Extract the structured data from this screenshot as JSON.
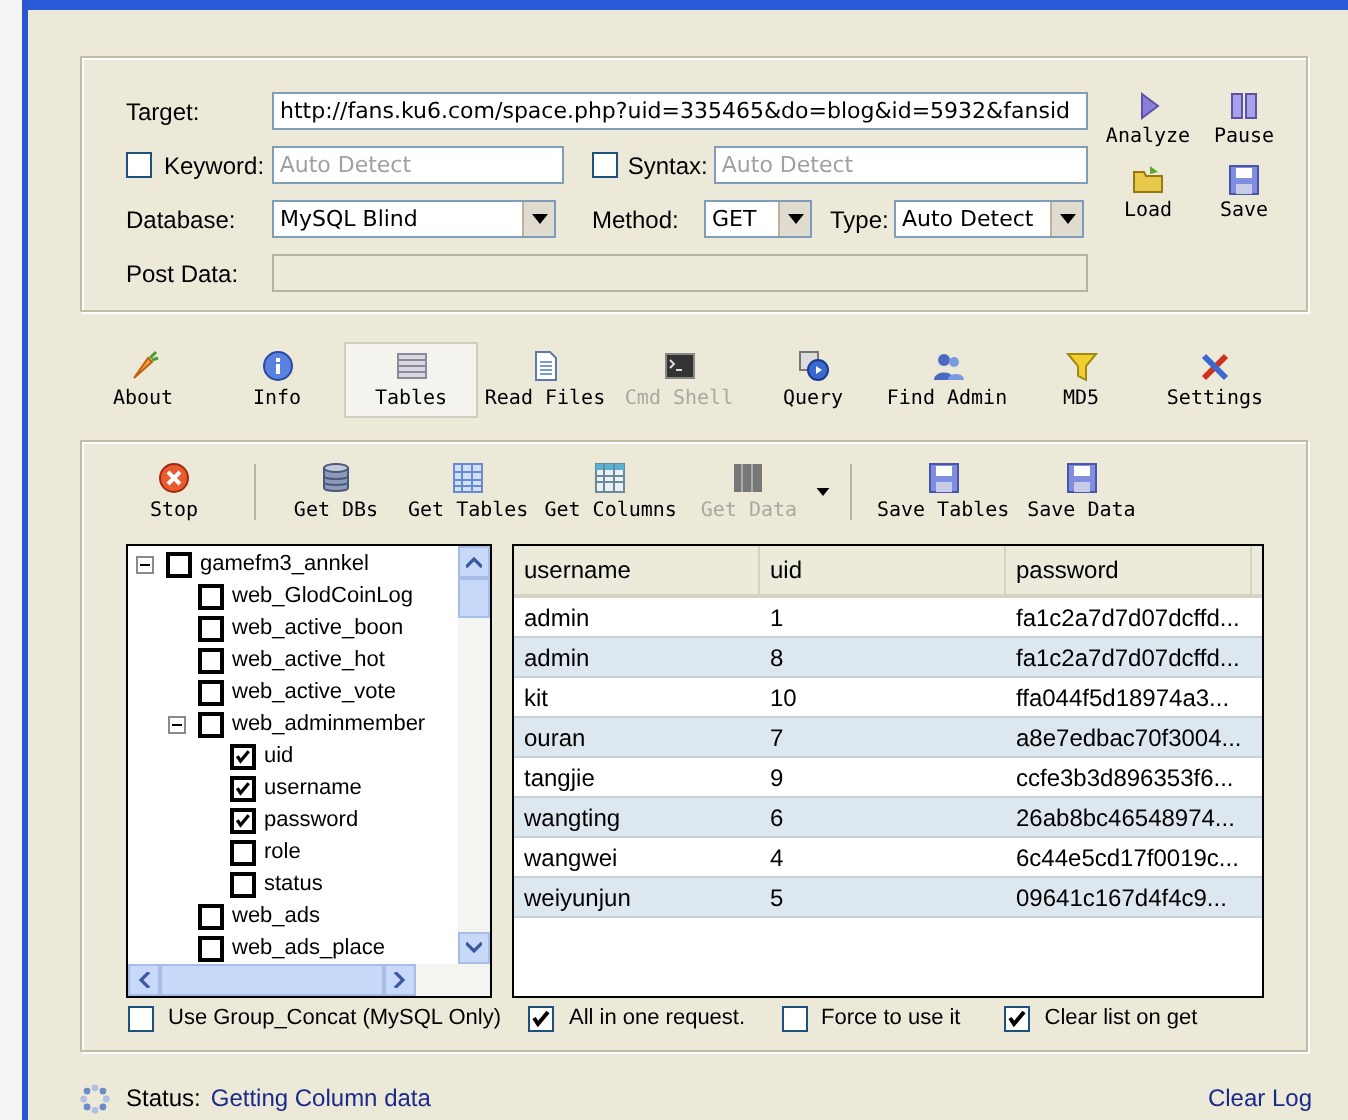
{
  "target": {
    "label": "Target:",
    "value": "http://fans.ku6.com/space.php?uid=335465&do=blog&id=5932&fansid"
  },
  "keyword": {
    "label": "Keyword:",
    "checked": false,
    "placeholder": "Auto Detect"
  },
  "syntax": {
    "label": "Syntax:",
    "checked": false,
    "placeholder": "Auto Detect"
  },
  "database": {
    "label": "Database:",
    "value": "MySQL Blind"
  },
  "method": {
    "label": "Method:",
    "value": "GET"
  },
  "type": {
    "label": "Type:",
    "value": "Auto Detect"
  },
  "post_data": {
    "label": "Post Data:",
    "disabled": true
  },
  "actions": [
    {
      "label": "Analyze"
    },
    {
      "label": "Pause"
    },
    {
      "label": "Load"
    },
    {
      "label": "Save"
    }
  ],
  "tabs": [
    {
      "label": "About",
      "selected": false,
      "disabled": false
    },
    {
      "label": "Info",
      "selected": false,
      "disabled": false
    },
    {
      "label": "Tables",
      "selected": true,
      "disabled": false
    },
    {
      "label": "Read Files",
      "selected": false,
      "disabled": false
    },
    {
      "label": "Cmd Shell",
      "selected": false,
      "disabled": true
    },
    {
      "label": "Query",
      "selected": false,
      "disabled": false
    },
    {
      "label": "Find Admin",
      "selected": false,
      "disabled": false
    },
    {
      "label": "MD5",
      "selected": false,
      "disabled": false
    },
    {
      "label": "Settings",
      "selected": false,
      "disabled": false
    }
  ],
  "toolbar": [
    {
      "kind": "button",
      "label": "Stop",
      "disabled": false
    },
    {
      "kind": "separator"
    },
    {
      "kind": "button",
      "label": "Get DBs",
      "disabled": false
    },
    {
      "kind": "button",
      "label": "Get Tables",
      "disabled": false
    },
    {
      "kind": "button",
      "label": "Get Columns",
      "disabled": false
    },
    {
      "kind": "button",
      "label": "Get Data",
      "disabled": true
    },
    {
      "kind": "dropdown"
    },
    {
      "kind": "separator"
    },
    {
      "kind": "button",
      "label": "Save Tables",
      "disabled": false
    },
    {
      "kind": "button",
      "label": "Save Data",
      "disabled": false
    }
  ],
  "tree": [
    {
      "label": "gamefm3_annkel",
      "checked": false,
      "expanded": true,
      "children": [
        {
          "label": "web_GlodCoinLog",
          "checked": false
        },
        {
          "label": "web_active_boon",
          "checked": false
        },
        {
          "label": "web_active_hot",
          "checked": false
        },
        {
          "label": "web_active_vote",
          "checked": false
        },
        {
          "label": "web_adminmember",
          "checked": false,
          "expanded": true,
          "children": [
            {
              "label": "uid",
              "checked": true
            },
            {
              "label": "username",
              "checked": true
            },
            {
              "label": "password",
              "checked": true
            },
            {
              "label": "role",
              "checked": false
            },
            {
              "label": "status",
              "checked": false
            }
          ]
        },
        {
          "label": "web_ads",
          "checked": false
        },
        {
          "label": "web_ads_place",
          "checked": false
        }
      ]
    }
  ],
  "table": {
    "columns": [
      "username",
      "uid",
      "password"
    ],
    "rows": [
      [
        "admin",
        "1",
        "fa1c2a7d7d07dcffd..."
      ],
      [
        "admin",
        "8",
        "fa1c2a7d7d07dcffd..."
      ],
      [
        "kit",
        "10",
        "ffa044f5d18974a3..."
      ],
      [
        "ouran",
        "7",
        "a8e7edbac70f3004..."
      ],
      [
        "tangjie",
        "9",
        "ccfe3b3d896353f6..."
      ],
      [
        "wangting",
        "6",
        "26ab8bc46548974..."
      ],
      [
        "wangwei",
        "4",
        "6c44e5cd17f0019c..."
      ],
      [
        "weiyunjun",
        "5",
        "09641c167d4f4c9..."
      ]
    ]
  },
  "options": [
    {
      "label": "Use Group_Concat (MySQL Only)",
      "checked": false
    },
    {
      "label": "All in one request.",
      "checked": true
    },
    {
      "label": "Force to use it",
      "checked": false
    },
    {
      "label": "Clear list on get",
      "checked": true
    }
  ],
  "status": {
    "label": "Status:",
    "value": "Getting Column data"
  },
  "clear_log": "Clear Log"
}
